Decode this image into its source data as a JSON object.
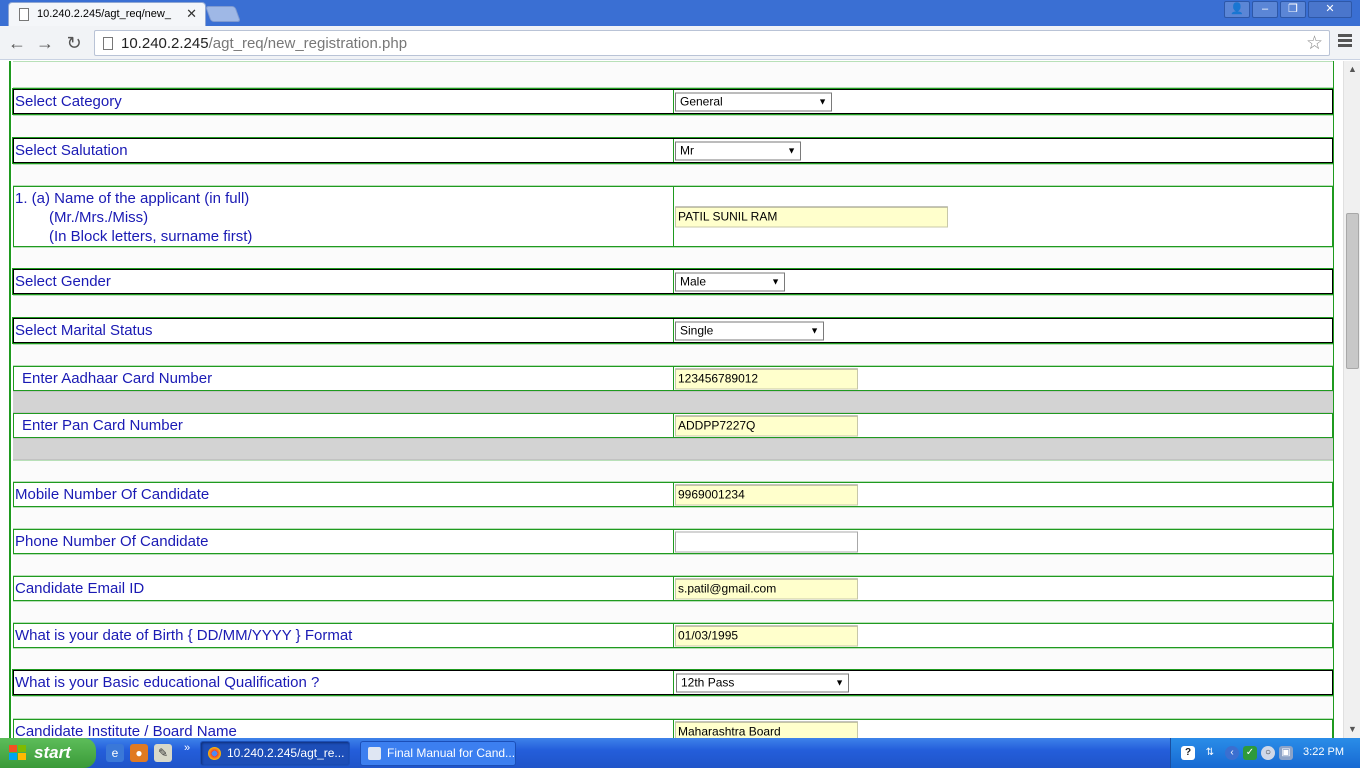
{
  "browser": {
    "tab_title": "10.240.2.245/agt_req/new_",
    "tab_close": "✕",
    "url_host": "10.240.2.245",
    "url_path": "/agt_req/new_registration.php",
    "back_icon": "←",
    "forward_icon": "→",
    "reload_icon": "↻",
    "star_icon": "☆",
    "window_user_icon": "👤",
    "window_min": "–",
    "window_max": "❐",
    "window_close": "✕"
  },
  "form": {
    "category": {
      "label": "Select Category",
      "value": "General"
    },
    "salutation": {
      "label": "Select Salutation",
      "value": "Mr"
    },
    "applicant_name": {
      "label_line1": "1. (a) Name of the applicant (in full)",
      "label_line2": "(Mr./Mrs./Miss)",
      "label_line3": "(In Block letters, surname first)",
      "value": "PATIL SUNIL RAM"
    },
    "gender": {
      "label": "Select Gender",
      "value": "Male"
    },
    "marital_status": {
      "label": "Select Marital Status",
      "value": "Single"
    },
    "aadhaar": {
      "label": "Enter Aadhaar Card Number",
      "value": "123456789012"
    },
    "pan": {
      "label": "Enter Pan Card Number",
      "value": "ADDPP7227Q"
    },
    "mobile": {
      "label": "Mobile Number Of Candidate",
      "value": "9969001234"
    },
    "phone": {
      "label": "Phone Number Of Candidate",
      "value": ""
    },
    "email": {
      "label": "Candidate Email ID",
      "value": "s.patil@gmail.com"
    },
    "dob": {
      "label": "What is your date of Birth { DD/MM/YYYY } Format",
      "value": "01/03/1995"
    },
    "qualification": {
      "label": "What is your Basic educational Qualification ?",
      "value": "12th Pass"
    },
    "institute": {
      "label": "Candidate Institute / Board Name",
      "value": "Maharashtra Board"
    }
  },
  "scrollbar": {
    "up": "▲",
    "down": "▼"
  },
  "taskbar": {
    "start_label": "start",
    "quick_more": "»",
    "task1": "10.240.2.245/agt_re...",
    "task2": "Final Manual for Cand...",
    "tray_help": "?",
    "clock": "3:22 PM"
  },
  "colors": {
    "form_border": "#1f9a1f",
    "label_text": "#1a1ab4",
    "filled_input": "#ffffcc",
    "taskbar": "#245edb"
  }
}
